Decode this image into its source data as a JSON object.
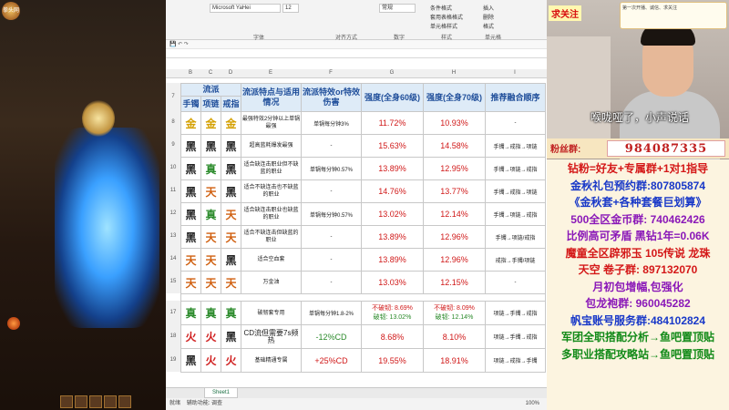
{
  "game": {
    "logo_text": "拳头网"
  },
  "excel": {
    "font_name": "Microsoft YaHei",
    "font_size": "12",
    "format": "常规",
    "ribbon_groups": [
      "字体",
      "对齐方式",
      "数字",
      "样式",
      "单元格"
    ],
    "ribbon_buttons": [
      "条件格式",
      "套用表格格式",
      "单元格样式",
      "插入",
      "删除",
      "格式"
    ],
    "col_letters": [
      "B",
      "C",
      "D",
      "E",
      "F",
      "G",
      "H",
      "I"
    ],
    "header": {
      "group": "流派",
      "sub": [
        "手镯",
        "项链",
        "戒指"
      ],
      "feature": "流派特点与适用情况",
      "effect": "流派特效or特效伤害",
      "lv60": "强度(全身60级)",
      "lv70": "强度(全身70级)",
      "order": "推荐融合顺序"
    },
    "rows": [
      {
        "num": "8",
        "c1": "金",
        "c2": "金",
        "c3": "金",
        "desc": "最强特效2分钟以上单锅最强",
        "eff": "单锅每分钟3%",
        "v60": "11.72%",
        "v70": "10.93%",
        "ord": "-"
      },
      {
        "num": "9",
        "c1": "黑",
        "c2": "黑",
        "c3": "黑",
        "desc": "超高蓝耗爆发最强",
        "eff": "-",
        "v60": "15.63%",
        "v70": "14.58%",
        "ord": "手镯→戒指→项链"
      },
      {
        "num": "10",
        "c1": "黑",
        "c2": "真",
        "c3": "黑",
        "desc": "适合缺连击职业但不缺蓝的职业",
        "eff": "单锅每分钟0.57%",
        "v60": "13.89%",
        "v70": "12.95%",
        "ord": "手镯→项链→戒指"
      },
      {
        "num": "11",
        "c1": "黑",
        "c2": "天",
        "c3": "黑",
        "desc": "适合不缺连击也不缺蓝的职业",
        "eff": "-",
        "v60": "14.76%",
        "v70": "13.77%",
        "ord": "手镯→戒指→项链"
      },
      {
        "num": "12",
        "c1": "黑",
        "c2": "真",
        "c3": "天",
        "desc": "适合缺连击职业也缺蓝的职业",
        "eff": "单锅每分钟0.57%",
        "v60": "13.02%",
        "v70": "12.14%",
        "ord": "手镯→项链→戒指"
      },
      {
        "num": "13",
        "c1": "黑",
        "c2": "天",
        "c3": "天",
        "desc": "适合不缺连击但缺蓝的职业",
        "eff": "-",
        "v60": "13.89%",
        "v70": "12.96%",
        "ord": "手镯→项链/戒指"
      },
      {
        "num": "14",
        "c1": "天",
        "c2": "天",
        "c3": "黑",
        "desc": "适合空血套",
        "eff": "-",
        "v60": "13.89%",
        "v70": "12.96%",
        "ord": "戒指→手镯/项链"
      },
      {
        "num": "15",
        "c1": "天",
        "c2": "天",
        "c3": "天",
        "desc": "万金油",
        "eff": "-",
        "v60": "13.03%",
        "v70": "12.15%",
        "ord": "-"
      },
      {
        "num": "17",
        "c1": "真",
        "c2": "真",
        "c3": "真",
        "desc": "破韧套专用",
        "eff": "单锅每分钟1.8-2%",
        "v60a": "不破韧: 8.69%",
        "v60b": "破韧: 13.02%",
        "v70a": "不破韧: 8.09%",
        "v70b": "破韧: 12.14%",
        "ord": "项链→手镯→戒指"
      },
      {
        "num": "18",
        "c1": "火",
        "c2": "火",
        "c3": "黑",
        "desc": "CD流但需要7s频热",
        "eff": "-12%CD",
        "v60": "8.68%",
        "v70": "8.10%",
        "ord": "项链→手镯→戒指"
      },
      {
        "num": "19",
        "c1": "黑",
        "c2": "火",
        "c3": "火",
        "desc": "基础精通专属",
        "eff": "+25%CD",
        "v60": "19.55%",
        "v70": "18.91%",
        "ord": "项链→戒指→手镯"
      }
    ],
    "sheet_tab": "Sheet1",
    "status_left": "就绪",
    "status_access": "辅助功能: 调查",
    "zoom": "100%"
  },
  "panel": {
    "follow": "求关注",
    "subtitle": "喉咙哑了，小声说话",
    "fans_label": "粉丝群:",
    "fans_number": "984087335",
    "card_text": "第一次开播、诚信、求关注",
    "lines": [
      {
        "text": "钻粉=好友+专属群+1对1指导",
        "color": "red"
      },
      {
        "text": "金秋礼包预约群:807805874",
        "color": "blue"
      },
      {
        "text": "《金秋套+各种套餐巨划算》",
        "color": "blue"
      },
      {
        "text": "500全区金币群: 740462426",
        "color": "pur"
      },
      {
        "text": "比例高可矛盾 黑钻1年=0.06K",
        "color": "pur"
      },
      {
        "text": "魔童全区辟邪玉 105传说 龙珠",
        "color": "red"
      },
      {
        "text": "天空 卷子群: 897132070",
        "color": "red"
      },
      {
        "text": "月初包增幅,包强化",
        "color": "pur"
      },
      {
        "text": "包龙袍群: 960045282",
        "color": "pur"
      },
      {
        "text": "帆宝账号服务群:484102824",
        "color": "blue"
      },
      {
        "text": "军团全职搭配分析→鱼吧置顶贴",
        "color": "grn"
      },
      {
        "text": "多职业搭配攻略站→鱼吧置顶贴",
        "color": "grn"
      }
    ]
  }
}
